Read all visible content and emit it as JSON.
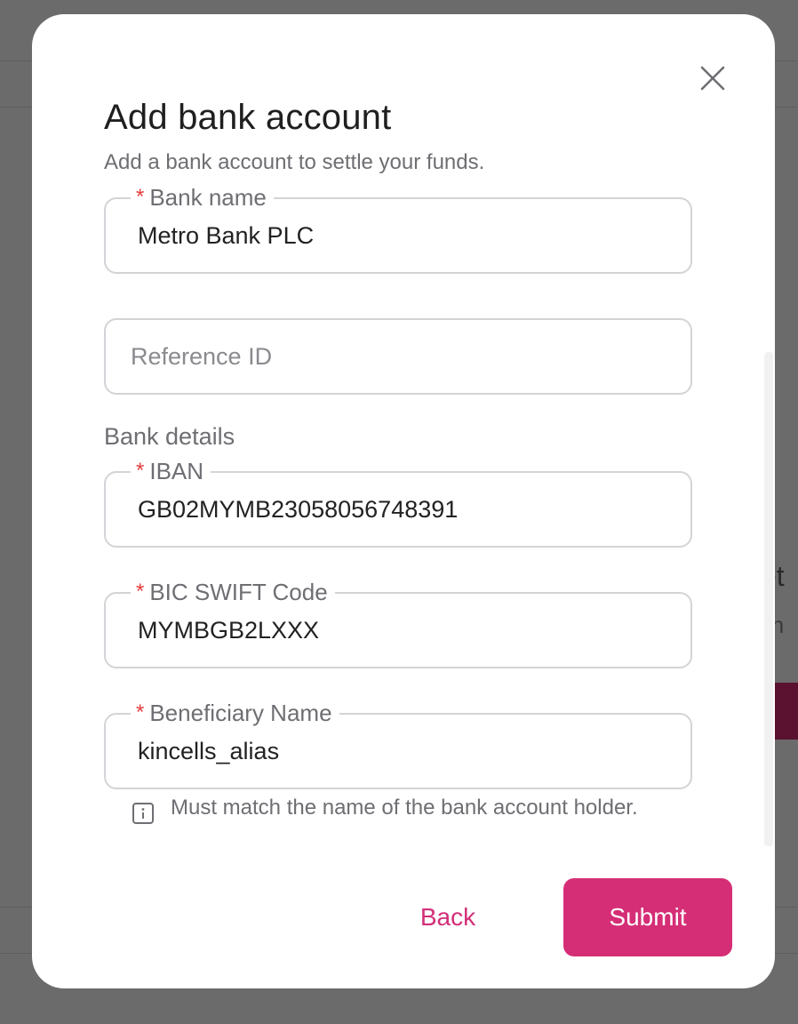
{
  "background": {
    "peek_heading": "et",
    "peek_text": "in"
  },
  "modal": {
    "title": "Add bank account",
    "subtitle": "Add a bank account to settle your funds.",
    "fields": {
      "bank_name": {
        "label": "Bank name",
        "required": "*",
        "value": "Metro Bank PLC"
      },
      "reference_id": {
        "placeholder": "Reference ID",
        "value": ""
      },
      "iban": {
        "label": "IBAN",
        "required": "*",
        "value": "GB02MYMB23058056748391"
      },
      "bic": {
        "label": "BIC SWIFT Code",
        "required": "*",
        "value": "MYMBGB2LXXX"
      },
      "beneficiary": {
        "label": "Beneficiary Name",
        "required": "*",
        "value": "kincells_alias"
      }
    },
    "section_bank_details": "Bank details",
    "hint": "Must match the name of the bank account holder.",
    "buttons": {
      "back": "Back",
      "submit": "Submit"
    }
  },
  "colors": {
    "accent": "#d52e76",
    "required": "#e53e3e",
    "overlay": "#6b6b6b"
  },
  "icons": {
    "close": "close-icon",
    "info": "info-icon"
  }
}
